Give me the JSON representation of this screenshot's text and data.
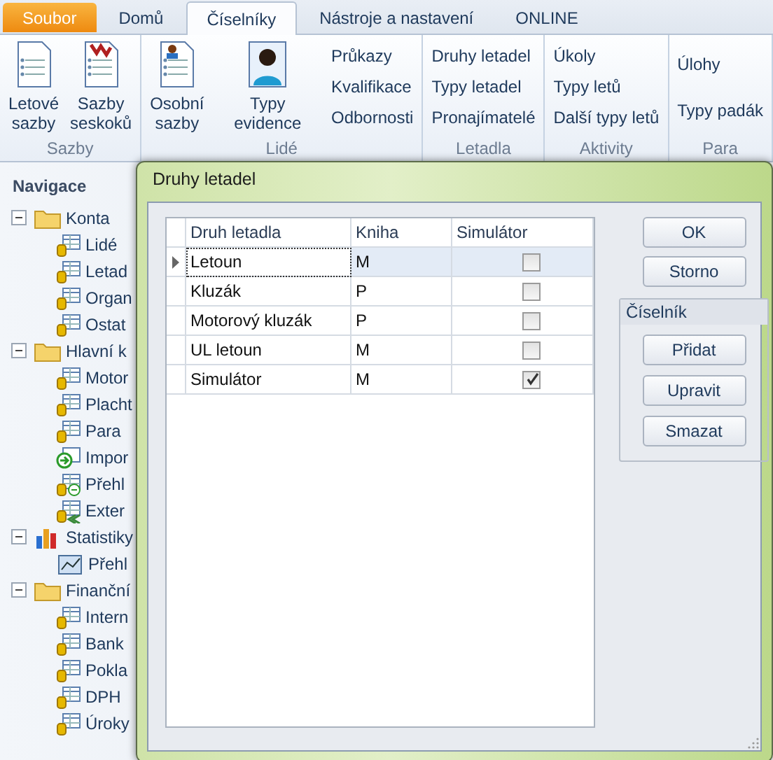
{
  "tabs": [
    {
      "label": "Soubor",
      "kind": "file",
      "selected": false
    },
    {
      "label": "Domů",
      "kind": "tab",
      "selected": false
    },
    {
      "label": "Číselníky",
      "kind": "tab",
      "selected": true
    },
    {
      "label": "Nástroje a nastavení",
      "kind": "tab",
      "selected": false
    },
    {
      "label": "ONLINE",
      "kind": "tab",
      "selected": false
    }
  ],
  "ribbon_groups": [
    {
      "label": "Sazby",
      "items": [
        {
          "label": "Letové\nsazby",
          "kind": "large"
        },
        {
          "label": "Sazby\nseskoků",
          "kind": "large"
        }
      ]
    },
    {
      "label": "Lidé",
      "items": [
        {
          "label": "Osobní\nsazby",
          "kind": "large"
        },
        {
          "label": "Typy evidence",
          "kind": "large"
        },
        {
          "label": "Průkazy",
          "kind": "small"
        },
        {
          "label": "Kvalifikace",
          "kind": "small"
        },
        {
          "label": "Odbornosti",
          "kind": "small"
        }
      ]
    },
    {
      "label": "Letadla",
      "items": [
        {
          "label": "Druhy letadel",
          "kind": "small"
        },
        {
          "label": "Typy letadel",
          "kind": "small"
        },
        {
          "label": "Pronajímatelé",
          "kind": "small"
        }
      ]
    },
    {
      "label": "Aktivity",
      "items": [
        {
          "label": "Úkoly",
          "kind": "small"
        },
        {
          "label": "Typy letů",
          "kind": "small"
        },
        {
          "label": "Další typy letů",
          "kind": "small"
        }
      ]
    },
    {
      "label": "Para",
      "items": [
        {
          "label": "Úlohy",
          "kind": "small"
        },
        {
          "label": "Typy padák",
          "kind": "small"
        }
      ]
    }
  ],
  "navigation": {
    "title": "Navigace",
    "tree": [
      {
        "label": "Konta",
        "kind": "folder",
        "expanded": true,
        "children": [
          {
            "label": "Lidé",
            "kind": "table"
          },
          {
            "label": "Letad",
            "kind": "table"
          },
          {
            "label": "Organ",
            "kind": "table"
          },
          {
            "label": "Ostat",
            "kind": "table"
          }
        ]
      },
      {
        "label": "Hlavní k",
        "kind": "folder",
        "expanded": true,
        "children": [
          {
            "label": "Motor",
            "kind": "table"
          },
          {
            "label": "Placht",
            "kind": "table"
          },
          {
            "label": "Para",
            "kind": "table"
          },
          {
            "label": "Impor",
            "kind": "import"
          },
          {
            "label": "Přehl",
            "kind": "table-import"
          },
          {
            "label": "Exter",
            "kind": "link"
          }
        ]
      },
      {
        "label": "Statistiky",
        "kind": "stats",
        "expanded": true,
        "children": [
          {
            "label": "Přehl",
            "kind": "chart"
          }
        ]
      },
      {
        "label": "Finanční",
        "kind": "folder",
        "expanded": true,
        "children": [
          {
            "label": "Intern",
            "kind": "table"
          },
          {
            "label": "Bank",
            "kind": "table"
          },
          {
            "label": "Pokla",
            "kind": "table"
          },
          {
            "label": "DPH",
            "kind": "table"
          },
          {
            "label": "Úroky",
            "kind": "table"
          }
        ]
      }
    ]
  },
  "dialog": {
    "title": "Druhy letadel",
    "table": {
      "columns": [
        "Druh letadla",
        "Kniha",
        "Simulátor"
      ],
      "rows": [
        {
          "name": "Letoun",
          "book": "M",
          "simulator": false,
          "selected": true
        },
        {
          "name": "Kluzák",
          "book": "P",
          "simulator": false,
          "selected": false
        },
        {
          "name": "Motorový kluzák",
          "book": "P",
          "simulator": false,
          "selected": false
        },
        {
          "name": "UL letoun",
          "book": "M",
          "simulator": false,
          "selected": false
        },
        {
          "name": "Simulátor",
          "book": "M",
          "simulator": true,
          "selected": false
        }
      ]
    },
    "buttons": [
      "OK",
      "Storno"
    ],
    "group": {
      "title": "Číselník",
      "buttons": [
        "Přidat",
        "Upravit",
        "Smazat"
      ]
    }
  }
}
